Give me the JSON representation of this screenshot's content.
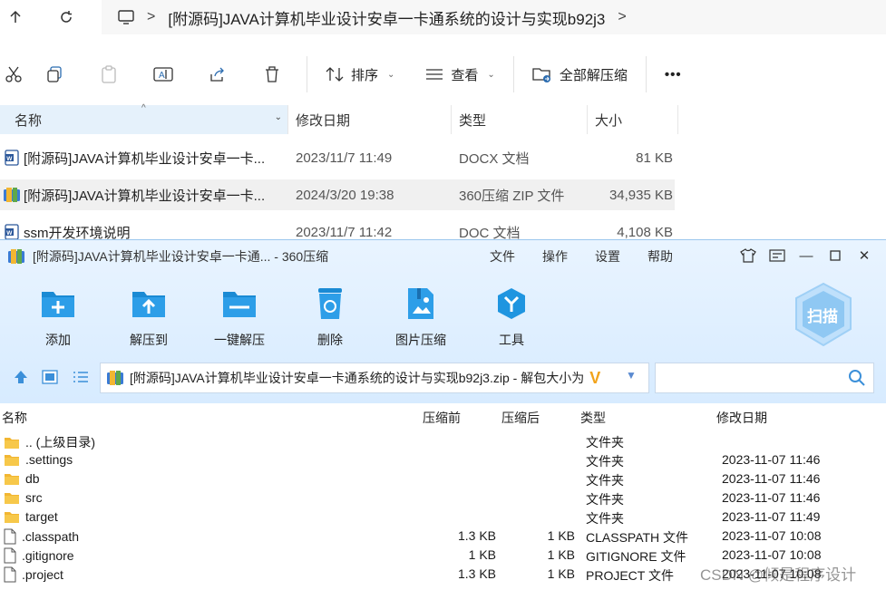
{
  "explorer": {
    "breadcrumb": "[附源码]JAVA计算机毕业设计安卓一卡通系统的设计与实现b92j3",
    "toolbar": {
      "sort_label": "排序",
      "view_label": "查看",
      "extract_all_label": "全部解压缩",
      "more_label": "•••"
    },
    "columns": {
      "name": "名称",
      "date": "修改日期",
      "type": "类型",
      "size": "大小"
    },
    "files": [
      {
        "name": "[附源码]JAVA计算机毕业设计安卓一卡...",
        "date": "2023/11/7 11:49",
        "type": "DOCX 文档",
        "size": "81 KB",
        "icon": "word-doc-icon"
      },
      {
        "name": "[附源码]JAVA计算机毕业设计安卓一卡...",
        "date": "2024/3/20 19:38",
        "type": "360压缩 ZIP 文件",
        "size": "34,935 KB",
        "icon": "zip-archive-icon"
      },
      {
        "name": "ssm开发环境说明",
        "date": "2023/11/7 11:42",
        "type": "DOC 文档",
        "size": "4,108 KB",
        "icon": "word-doc-icon"
      }
    ]
  },
  "zip": {
    "title": "[附源码]JAVA计算机毕业设计安卓一卡通... - 360压缩",
    "menu": [
      "文件",
      "操作",
      "设置",
      "帮助"
    ],
    "tools": [
      "添加",
      "解压到",
      "一键解压",
      "删除",
      "图片压缩",
      "工具"
    ],
    "scan_label": "扫描",
    "address": "[附源码]JAVA计算机毕业设计安卓一卡通系统的设计与实现b92j3.zip - 解包大小为",
    "columns": {
      "name": "名称",
      "packed": "压缩前",
      "unpacked": "压缩后",
      "type": "类型",
      "date": "修改日期"
    },
    "entries": [
      {
        "name": ".. (上级目录)",
        "packed": "",
        "unpacked": "",
        "type": "文件夹",
        "date": "",
        "kind": "folder"
      },
      {
        "name": ".settings",
        "packed": "",
        "unpacked": "",
        "type": "文件夹",
        "date": "2023-11-07 11:46",
        "kind": "folder"
      },
      {
        "name": "db",
        "packed": "",
        "unpacked": "",
        "type": "文件夹",
        "date": "2023-11-07 11:46",
        "kind": "folder"
      },
      {
        "name": "src",
        "packed": "",
        "unpacked": "",
        "type": "文件夹",
        "date": "2023-11-07 11:46",
        "kind": "folder"
      },
      {
        "name": "target",
        "packed": "",
        "unpacked": "",
        "type": "文件夹",
        "date": "2023-11-07 11:49",
        "kind": "folder"
      },
      {
        "name": ".classpath",
        "packed": "1.3 KB",
        "unpacked": "1 KB",
        "type": "CLASSPATH 文件",
        "date": "2023-11-07 10:08",
        "kind": "file"
      },
      {
        "name": ".gitignore",
        "packed": "1 KB",
        "unpacked": "1 KB",
        "type": "GITIGNORE 文件",
        "date": "2023-11-07 10:08",
        "kind": "file"
      },
      {
        "name": ".project",
        "packed": "1.3 KB",
        "unpacked": "1 KB",
        "type": "PROJECT 文件",
        "date": "2023-11-07 10:08",
        "kind": "file"
      }
    ]
  },
  "watermark": "CSDN @倾是程序设计"
}
